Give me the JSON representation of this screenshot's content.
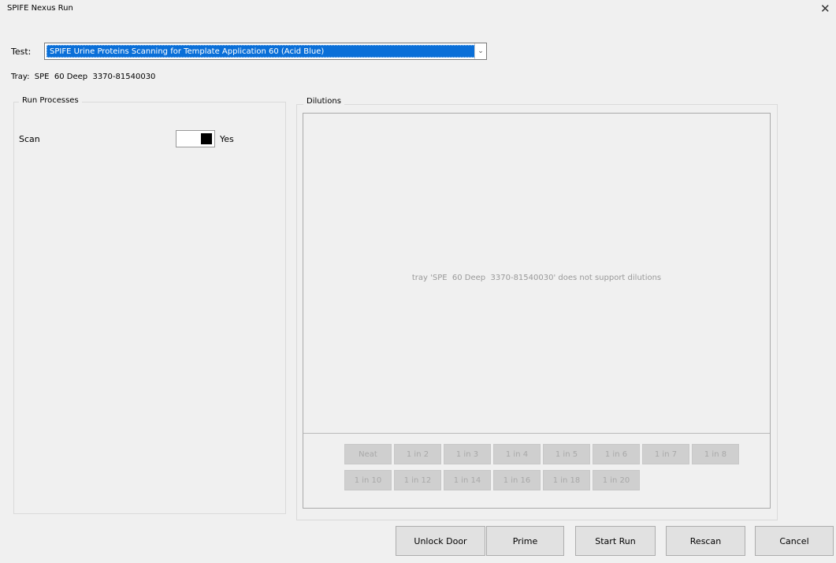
{
  "window": {
    "title": "SPIFE Nexus Run",
    "close_glyph": "✕"
  },
  "test": {
    "label": "Test:",
    "selected": "SPIFE Urine Proteins Scanning for Template Application 60 (Acid Blue)"
  },
  "tray": {
    "text": "Tray:  SPE  60 Deep  3370-81540030"
  },
  "run_processes": {
    "title": "Run Processes",
    "scan_label": "Scan",
    "scan_value": "Yes"
  },
  "dilutions": {
    "title": "Dilutions",
    "message": "tray 'SPE  60 Deep  3370-81540030' does not support dilutions",
    "row1": [
      "Neat",
      "1 in 2",
      "1 in 3",
      "1 in 4",
      "1 in 5",
      "1 in 6",
      "1 in 7",
      "1 in 8"
    ],
    "row2": [
      "1 in 10",
      "1 in 12",
      "1 in 14",
      "1 in 16",
      "1 in 18",
      "1 in 20"
    ]
  },
  "actions": {
    "unlock_door": "Unlock Door",
    "prime": "Prime",
    "start_run": "Start Run",
    "rescan": "Rescan",
    "cancel": "Cancel"
  }
}
